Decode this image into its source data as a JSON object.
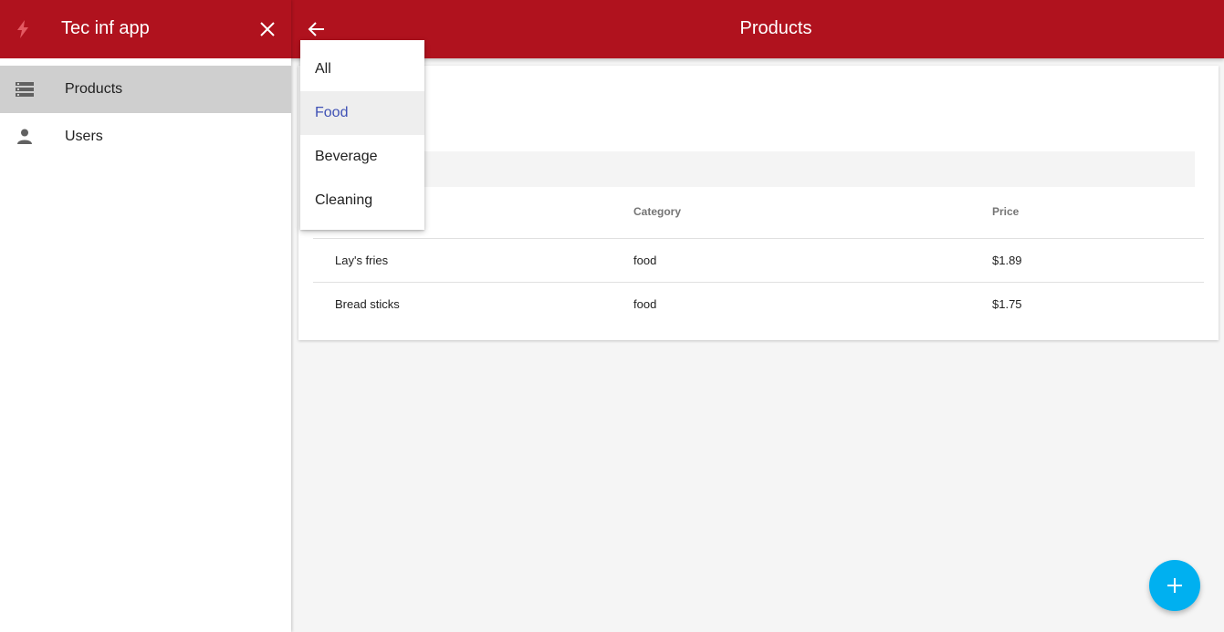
{
  "sidebar": {
    "app_title": "Tec inf app",
    "items": [
      {
        "label": "Products",
        "icon": "list-icon",
        "active": true
      },
      {
        "label": "Users",
        "icon": "person-icon",
        "active": false
      }
    ]
  },
  "header": {
    "title": "Products"
  },
  "filter_menu": {
    "options": [
      "All",
      "Food",
      "Beverage",
      "Cleaning"
    ],
    "selected": "Food"
  },
  "table": {
    "columns": [
      "",
      "Category",
      "Price"
    ],
    "rows": [
      {
        "name": "Lay's fries",
        "category": "food",
        "price": "$1.89"
      },
      {
        "name": "Bread sticks",
        "category": "food",
        "price": "$1.75"
      }
    ]
  },
  "colors": {
    "primary": "#b0121e",
    "accent": "#00b0f0",
    "selected_text": "#3f51b5"
  }
}
